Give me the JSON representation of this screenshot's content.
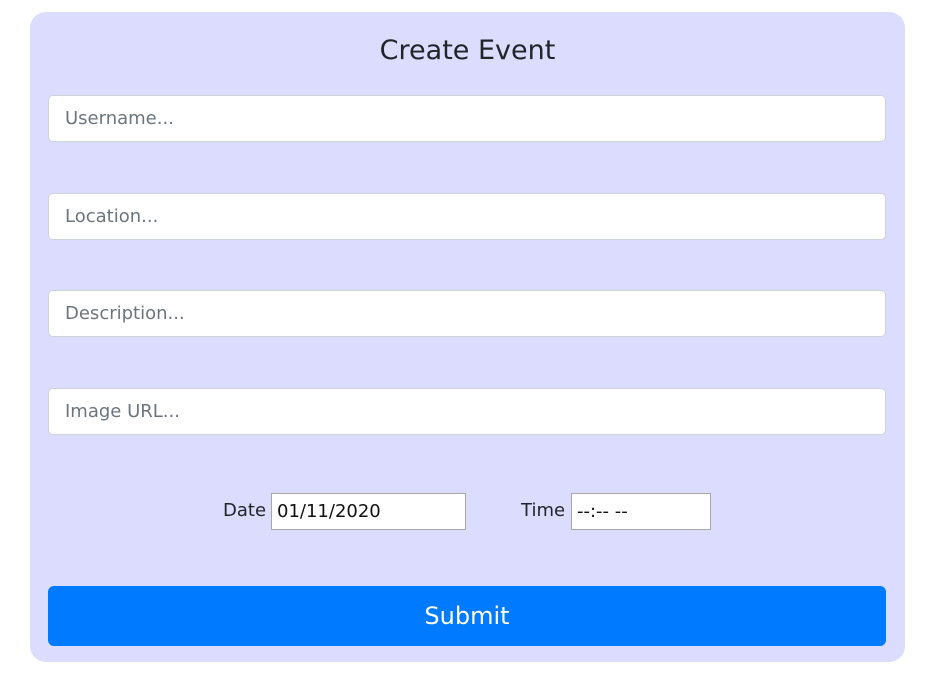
{
  "form": {
    "title": "Create Event",
    "fields": {
      "username_placeholder": "Username...",
      "location_placeholder": "Location...",
      "description_placeholder": "Description...",
      "image_url_placeholder": "Image URL..."
    },
    "date": {
      "label": "Date",
      "value": "01/11/2020"
    },
    "time": {
      "label": "Time",
      "value": "--:-- --"
    },
    "submit_label": "Submit"
  },
  "colors": {
    "card_background": "#dcdcff",
    "submit_background": "#007bff"
  }
}
